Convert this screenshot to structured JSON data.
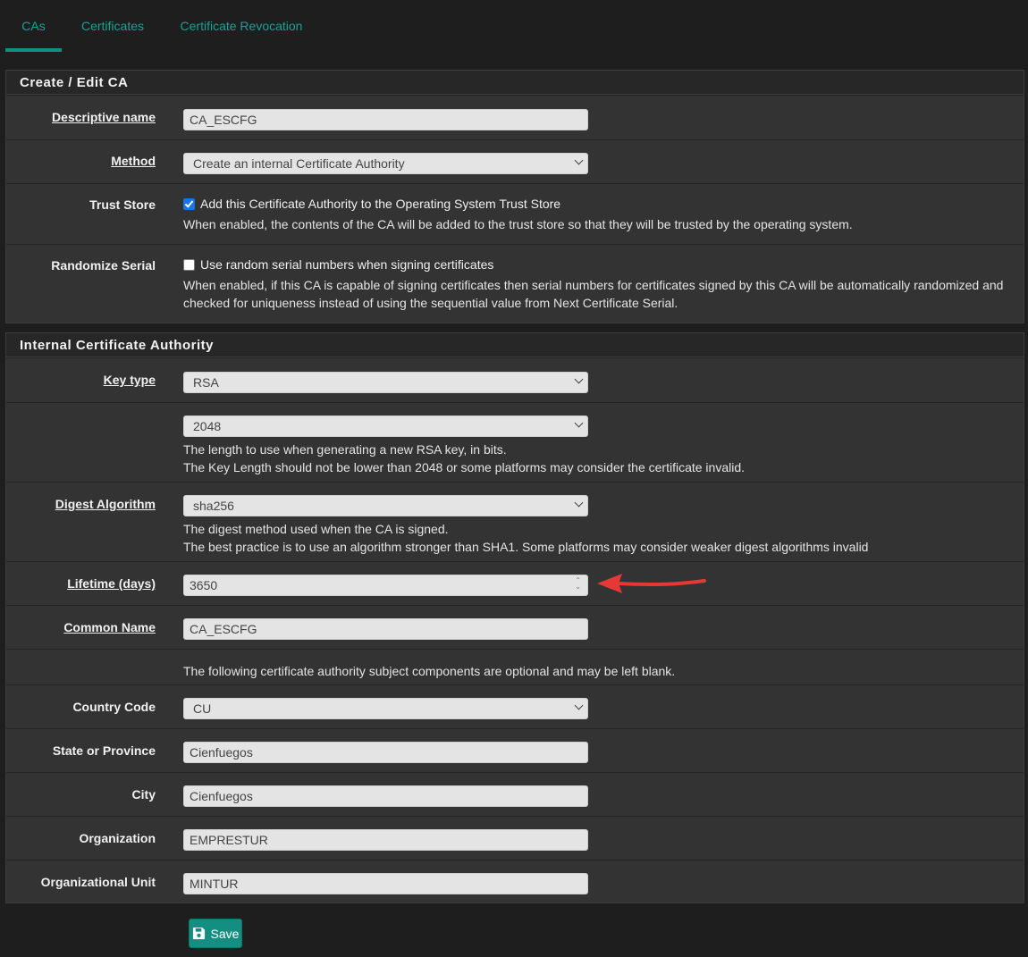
{
  "tabs": [
    {
      "label": "CAs",
      "active": true
    },
    {
      "label": "Certificates",
      "active": false
    },
    {
      "label": "Certificate Revocation",
      "active": false
    }
  ],
  "panel1": {
    "title": "Create / Edit CA",
    "descriptive_name": {
      "label": "Descriptive name",
      "value": "CA_ESCFG"
    },
    "method": {
      "label": "Method",
      "value": "Create an internal Certificate Authority"
    },
    "trust_store": {
      "label": "Trust Store",
      "checked": true,
      "checkbox_label": "Add this Certificate Authority to the Operating System Trust Store",
      "help": "When enabled, the contents of the CA will be added to the trust store so that they will be trusted by the operating system."
    },
    "randomize_serial": {
      "label": "Randomize Serial",
      "checked": false,
      "checkbox_label": "Use random serial numbers when signing certificates",
      "help_line1": "When enabled, if this CA is capable of signing certificates then serial numbers for certificates signed by this CA will be automatically randomized and",
      "help_line2": "checked for uniqueness instead of using the sequential value from Next Certificate Serial."
    }
  },
  "panel2": {
    "title": "Internal Certificate Authority",
    "key_type": {
      "label": "Key type",
      "value": "RSA"
    },
    "key_length": {
      "value": "2048",
      "help_line1": "The length to use when generating a new RSA key, in bits.",
      "help_line2": "The Key Length should not be lower than 2048 or some platforms may consider the certificate invalid."
    },
    "digest": {
      "label": "Digest Algorithm",
      "value": "sha256",
      "help_line1": "The digest method used when the CA is signed.",
      "help_line2": "The best practice is to use an algorithm stronger than SHA1. Some platforms may consider weaker digest algorithms invalid"
    },
    "lifetime": {
      "label": "Lifetime (days)",
      "value": "3650"
    },
    "common_name": {
      "label": "Common Name",
      "value": "CA_ESCFG"
    },
    "optional_note": "The following certificate authority subject components are optional and may be left blank.",
    "country": {
      "label": "Country Code",
      "value": "CU"
    },
    "state": {
      "label": "State or Province",
      "value": "Cienfuegos"
    },
    "city": {
      "label": "City",
      "value": "Cienfuegos"
    },
    "organization": {
      "label": "Organization",
      "value": "EMPRESTUR"
    },
    "org_unit": {
      "label": "Organizational Unit",
      "value": "MINTUR"
    }
  },
  "save": {
    "label": "Save"
  },
  "colors": {
    "accent": "#138f81",
    "arrow": "#e53935",
    "checkbox": "#1a73e8"
  }
}
